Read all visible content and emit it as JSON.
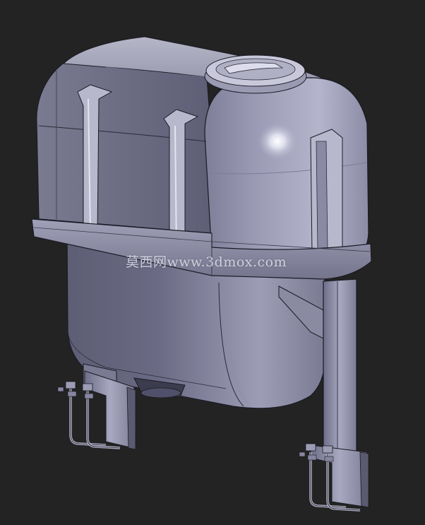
{
  "scene": {
    "subject_icon": "water-tank-3d-model",
    "colors": {
      "background": "#232323",
      "body_light": "#c9c9dc",
      "body_mid": "#8f8fa8",
      "body_dark": "#4a4a5e",
      "edge": "#1a1a24"
    }
  },
  "watermark": {
    "text": "莫西网www.3dmox.com"
  }
}
